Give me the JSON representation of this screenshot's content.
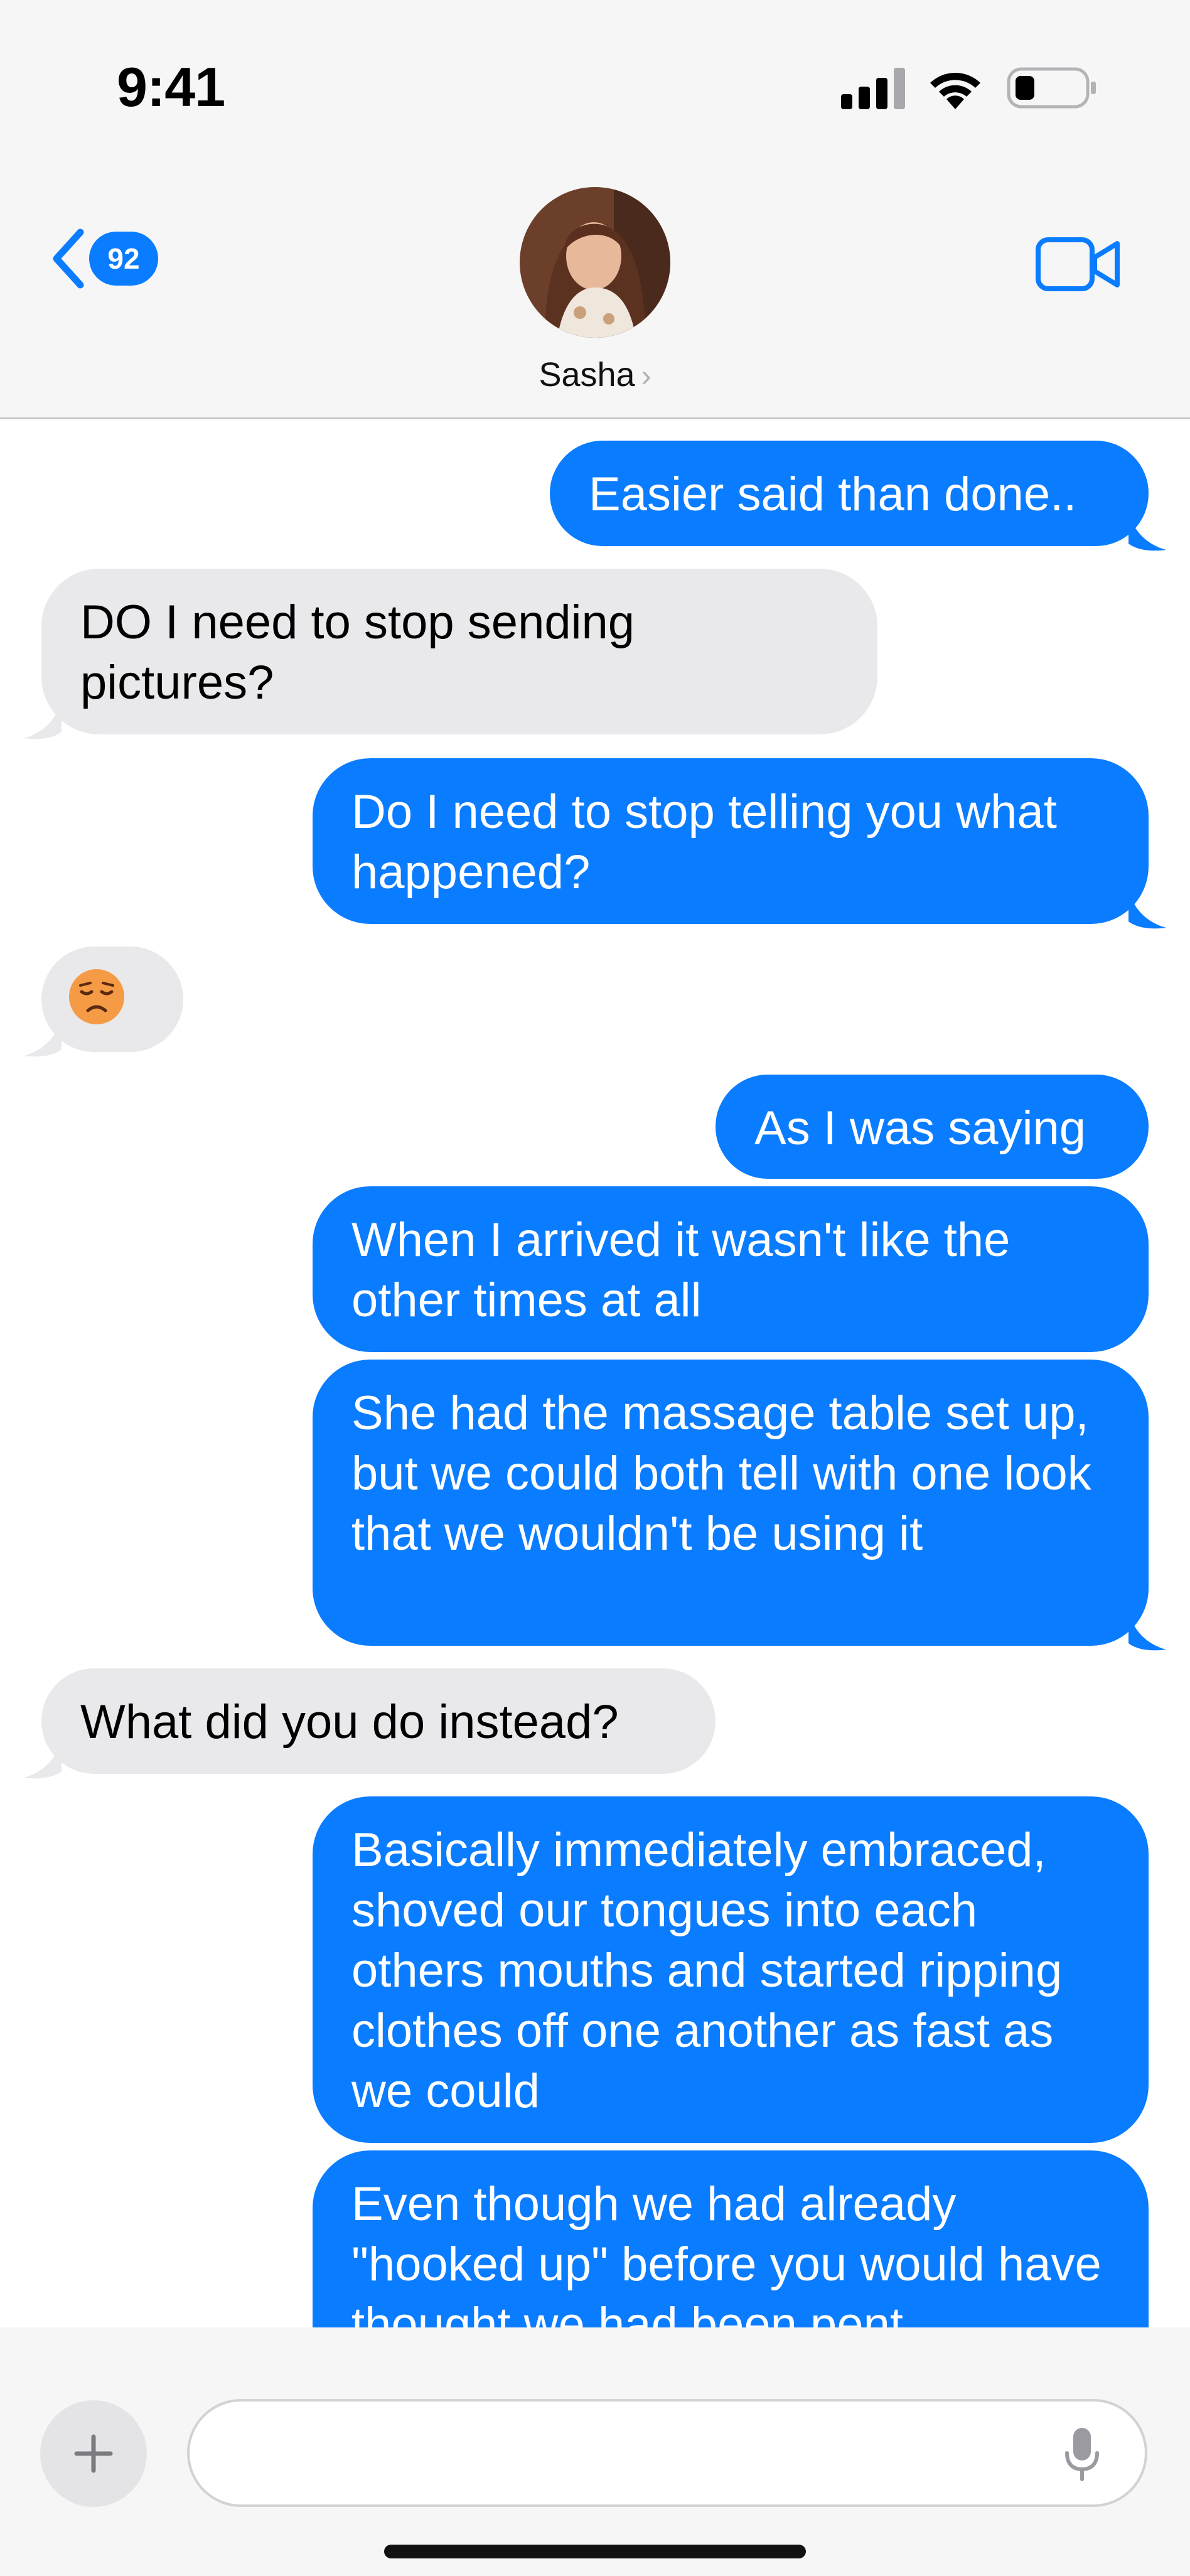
{
  "status": {
    "time": "9:41"
  },
  "header": {
    "back_count": "92",
    "contact_name": "Sasha",
    "contact_arrow": "›"
  },
  "messages": [
    {
      "side": "sent",
      "text": "Easier said than done.."
    },
    {
      "side": "received",
      "text": "DO I need to stop sending pictures?"
    },
    {
      "side": "sent",
      "text": "Do I need to stop telling you what happened?"
    },
    {
      "side": "received",
      "text": "",
      "emoji": "weary-face"
    },
    {
      "side": "sent",
      "text": "As I was saying"
    },
    {
      "side": "sent",
      "text": "When I arrived it wasn't like the other times at all"
    },
    {
      "side": "sent",
      "text": "She had the massage table set up, but we could both tell with one look that we wouldn't be using it"
    },
    {
      "side": "received",
      "text": "What did you do instead?"
    },
    {
      "side": "sent",
      "text": "Basically immediately embraced, shoved our tongues into each others mouths and started ripping clothes off one another as fast as we could"
    },
    {
      "side": "sent",
      "text": "Even though we had already \"hooked up\" before you would have thought we had been pent"
    }
  ],
  "composer": {
    "placeholder": ""
  },
  "colors": {
    "sent_bubble": "#0a7cff",
    "received_bubble": "#e9e9eb",
    "accent": "#0a7cff"
  },
  "icons": [
    "back-chevron-icon",
    "video-call-icon",
    "plus-icon",
    "microphone-icon",
    "cellular-signal-icon",
    "wifi-icon",
    "battery-icon"
  ]
}
